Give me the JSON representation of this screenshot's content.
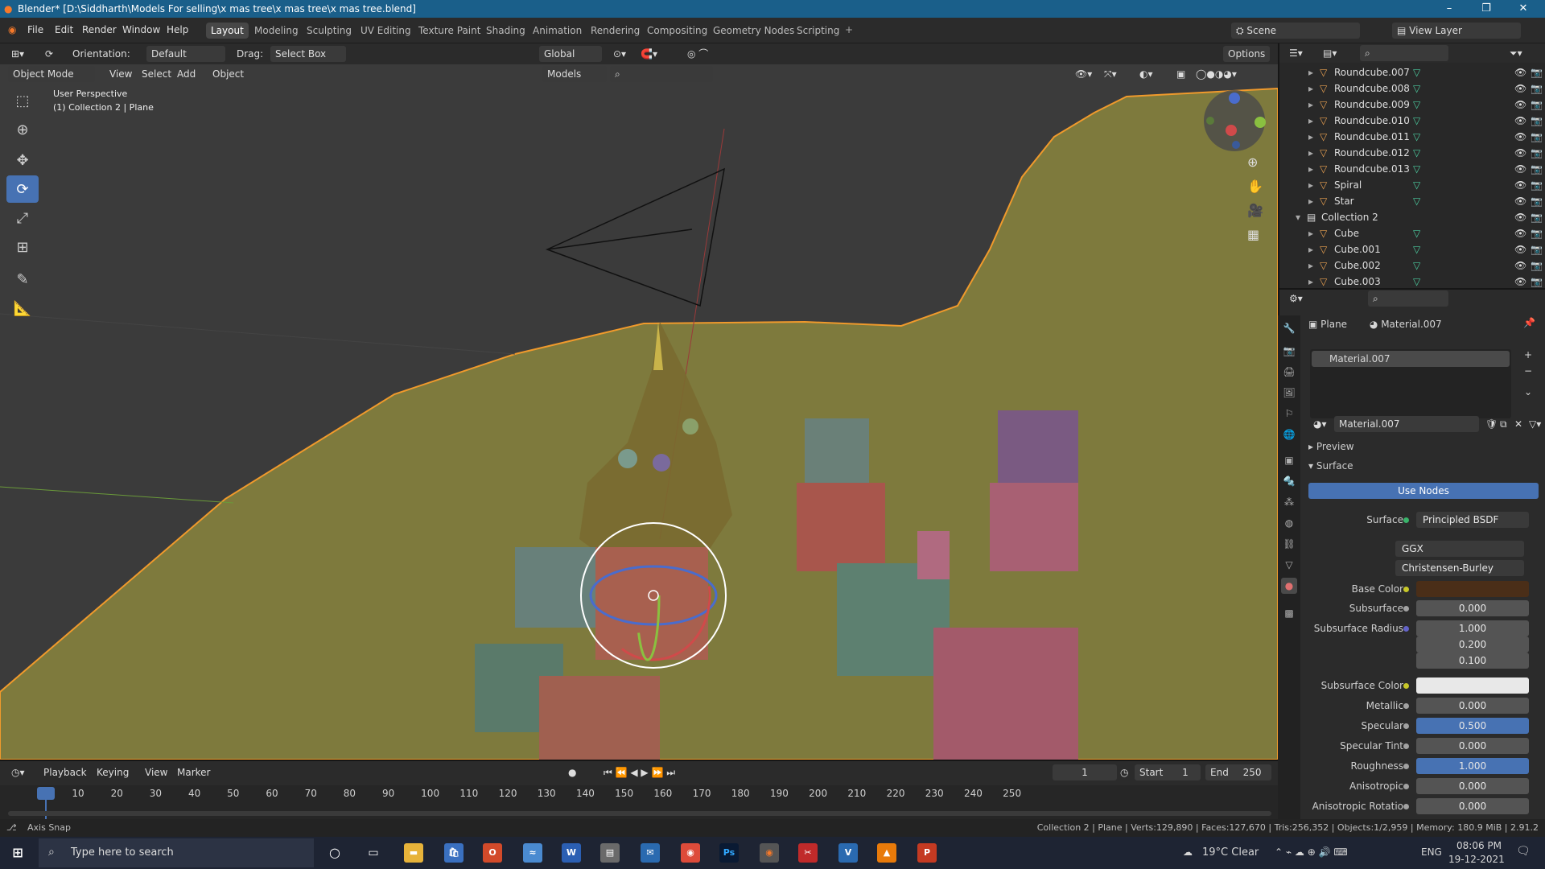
{
  "window": {
    "title": "Blender* [D:\\Siddharth\\Models For selling\\x mas tree\\x mas tree\\x mas tree.blend]",
    "controls": [
      "–",
      "❐",
      "✕"
    ]
  },
  "menu": [
    "File",
    "Edit",
    "Render",
    "Window",
    "Help"
  ],
  "workspaces": [
    "Layout",
    "Modeling",
    "Sculpting",
    "UV Editing",
    "Texture Paint",
    "Shading",
    "Animation",
    "Rendering",
    "Compositing",
    "Geometry Nodes",
    "Scripting"
  ],
  "active_workspace": "Layout",
  "scene": {
    "label": "Scene",
    "view_layer": "View Layer"
  },
  "toolbar": {
    "orientation_label": "Orientation:",
    "orientation_value": "Default",
    "drag_label": "Drag:",
    "drag_value": "Select Box",
    "transform_global": "Global",
    "options": "Options"
  },
  "viewport_header": {
    "mode": "Object Mode",
    "menus": [
      "View",
      "Select",
      "Add",
      "Object"
    ],
    "collection": "Models"
  },
  "viewport": {
    "perspective": "User Perspective",
    "active": "(1) Collection 2 | Plane",
    "gizmo_axes": [
      "X",
      "Y",
      "Z"
    ]
  },
  "outliner": {
    "items": [
      {
        "name": "Roundcube.007",
        "indent": 2
      },
      {
        "name": "Roundcube.008",
        "indent": 2
      },
      {
        "name": "Roundcube.009",
        "indent": 2
      },
      {
        "name": "Roundcube.010",
        "indent": 2
      },
      {
        "name": "Roundcube.011",
        "indent": 2
      },
      {
        "name": "Roundcube.012",
        "indent": 2
      },
      {
        "name": "Roundcube.013",
        "indent": 2
      },
      {
        "name": "Spiral",
        "indent": 2
      },
      {
        "name": "Star",
        "indent": 2
      },
      {
        "name": "Collection 2",
        "indent": 1
      },
      {
        "name": "Cube",
        "indent": 2
      },
      {
        "name": "Cube.001",
        "indent": 2
      },
      {
        "name": "Cube.002",
        "indent": 2
      },
      {
        "name": "Cube.003",
        "indent": 2
      }
    ]
  },
  "properties": {
    "breadcrumb_object": "Plane",
    "breadcrumb_material": "Material.007",
    "slot": "Material.007",
    "material_name": "Material.007",
    "panel_preview": "Preview",
    "panel_surface": "Surface",
    "use_nodes": "Use Nodes",
    "surface_label": "Surface",
    "surface_value": "Principled BSDF",
    "distribution": "GGX",
    "subsurface_method": "Christensen-Burley",
    "base_color_label": "Base Color",
    "base_color_hex": "#4a2e18",
    "subsurface_color_hex": "#e8e8e8",
    "fields": [
      {
        "label": "Subsurface",
        "value": "0.000"
      },
      {
        "label": "Subsurface Radius",
        "value": "1.000"
      },
      {
        "label": "",
        "value": "0.200"
      },
      {
        "label": "",
        "value": "0.100"
      },
      {
        "label": "Subsurface Color",
        "value": ""
      },
      {
        "label": "Metallic",
        "value": "0.000"
      },
      {
        "label": "Specular",
        "value": "0.500"
      },
      {
        "label": "Specular Tint",
        "value": "0.000"
      },
      {
        "label": "Roughness",
        "value": "1.000"
      },
      {
        "label": "Anisotropic",
        "value": "0.000"
      },
      {
        "label": "Anisotropic Rotatio",
        "value": "0.000"
      }
    ]
  },
  "timeline": {
    "menus": [
      "Playback",
      "Keying",
      "View",
      "Marker"
    ],
    "current_frame": "1",
    "start_label": "Start",
    "start": "1",
    "end_label": "End",
    "end": "250",
    "ticks": [
      "1",
      "10",
      "20",
      "30",
      "40",
      "50",
      "60",
      "70",
      "80",
      "90",
      "100",
      "110",
      "120",
      "130",
      "140",
      "150",
      "160",
      "170",
      "180",
      "190",
      "200",
      "210",
      "220",
      "230",
      "240",
      "250"
    ]
  },
  "status": {
    "left": "Axis Snap",
    "right": "Collection 2 | Plane | Verts:129,890 | Faces:127,670 | Tris:256,352 | Objects:1/2,959 | Memory: 180.9 MiB | 2.91.2"
  },
  "taskbar": {
    "search_placeholder": "Type here to search",
    "weather": "19°C  Clear",
    "lang": "ENG",
    "time": "08:06 PM",
    "date": "19-12-2021"
  }
}
